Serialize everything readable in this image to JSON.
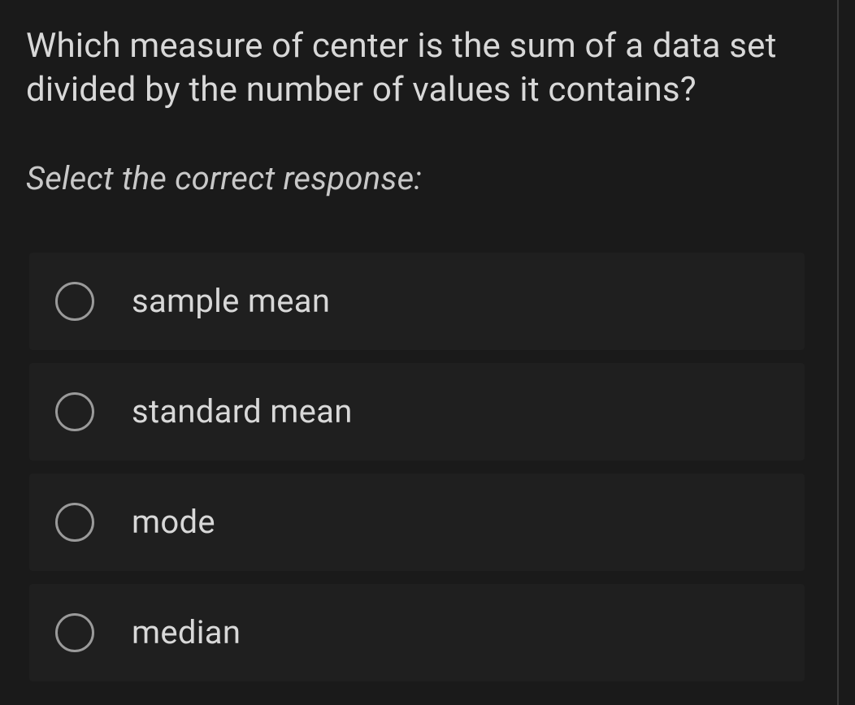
{
  "question": "Which measure of center is the sum of a data set divided by the number of values it contains?",
  "instruction": "Select the correct response:",
  "options": [
    {
      "label": "sample mean"
    },
    {
      "label": "standard mean"
    },
    {
      "label": "mode"
    },
    {
      "label": "median"
    }
  ]
}
